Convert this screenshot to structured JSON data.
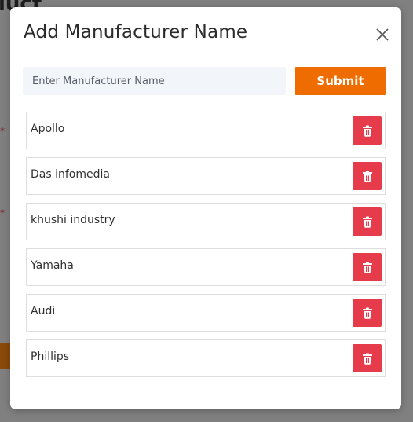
{
  "background": {
    "title_fragment": "luct",
    "asterisk": "*"
  },
  "modal": {
    "title": "Add Manufacturer Name",
    "close_icon": "close-icon",
    "input": {
      "placeholder": "Enter Manufacturer Name",
      "value": ""
    },
    "submit_label": "Submit",
    "delete_icon": "trash-icon",
    "manufacturers": [
      "Apollo",
      "Das infomedia",
      "khushi industry",
      "Yamaha",
      "Audi",
      "Phillips"
    ]
  },
  "colors": {
    "accent": "#ef6c00",
    "danger": "#e53b4a",
    "input_bg": "#f2f5f9"
  }
}
